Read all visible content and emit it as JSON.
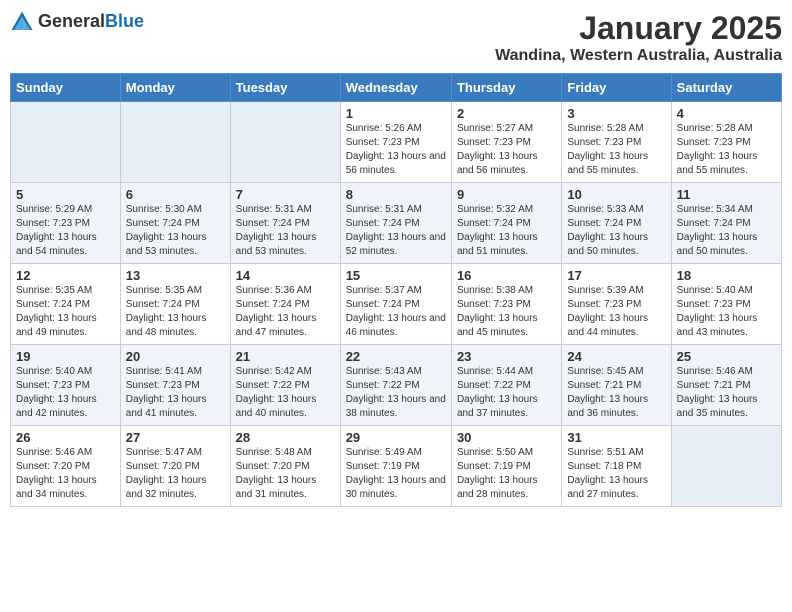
{
  "logo": {
    "general": "General",
    "blue": "Blue"
  },
  "header": {
    "month": "January 2025",
    "location": "Wandina, Western Australia, Australia"
  },
  "weekdays": [
    "Sunday",
    "Monday",
    "Tuesday",
    "Wednesday",
    "Thursday",
    "Friday",
    "Saturday"
  ],
  "weeks": [
    [
      {
        "day": "",
        "info": ""
      },
      {
        "day": "",
        "info": ""
      },
      {
        "day": "",
        "info": ""
      },
      {
        "day": "1",
        "info": "Sunrise: 5:26 AM\nSunset: 7:23 PM\nDaylight: 13 hours\nand 56 minutes."
      },
      {
        "day": "2",
        "info": "Sunrise: 5:27 AM\nSunset: 7:23 PM\nDaylight: 13 hours\nand 56 minutes."
      },
      {
        "day": "3",
        "info": "Sunrise: 5:28 AM\nSunset: 7:23 PM\nDaylight: 13 hours\nand 55 minutes."
      },
      {
        "day": "4",
        "info": "Sunrise: 5:28 AM\nSunset: 7:23 PM\nDaylight: 13 hours\nand 55 minutes."
      }
    ],
    [
      {
        "day": "5",
        "info": "Sunrise: 5:29 AM\nSunset: 7:23 PM\nDaylight: 13 hours\nand 54 minutes."
      },
      {
        "day": "6",
        "info": "Sunrise: 5:30 AM\nSunset: 7:24 PM\nDaylight: 13 hours\nand 53 minutes."
      },
      {
        "day": "7",
        "info": "Sunrise: 5:31 AM\nSunset: 7:24 PM\nDaylight: 13 hours\nand 53 minutes."
      },
      {
        "day": "8",
        "info": "Sunrise: 5:31 AM\nSunset: 7:24 PM\nDaylight: 13 hours\nand 52 minutes."
      },
      {
        "day": "9",
        "info": "Sunrise: 5:32 AM\nSunset: 7:24 PM\nDaylight: 13 hours\nand 51 minutes."
      },
      {
        "day": "10",
        "info": "Sunrise: 5:33 AM\nSunset: 7:24 PM\nDaylight: 13 hours\nand 50 minutes."
      },
      {
        "day": "11",
        "info": "Sunrise: 5:34 AM\nSunset: 7:24 PM\nDaylight: 13 hours\nand 50 minutes."
      }
    ],
    [
      {
        "day": "12",
        "info": "Sunrise: 5:35 AM\nSunset: 7:24 PM\nDaylight: 13 hours\nand 49 minutes."
      },
      {
        "day": "13",
        "info": "Sunrise: 5:35 AM\nSunset: 7:24 PM\nDaylight: 13 hours\nand 48 minutes."
      },
      {
        "day": "14",
        "info": "Sunrise: 5:36 AM\nSunset: 7:24 PM\nDaylight: 13 hours\nand 47 minutes."
      },
      {
        "day": "15",
        "info": "Sunrise: 5:37 AM\nSunset: 7:24 PM\nDaylight: 13 hours\nand 46 minutes."
      },
      {
        "day": "16",
        "info": "Sunrise: 5:38 AM\nSunset: 7:23 PM\nDaylight: 13 hours\nand 45 minutes."
      },
      {
        "day": "17",
        "info": "Sunrise: 5:39 AM\nSunset: 7:23 PM\nDaylight: 13 hours\nand 44 minutes."
      },
      {
        "day": "18",
        "info": "Sunrise: 5:40 AM\nSunset: 7:23 PM\nDaylight: 13 hours\nand 43 minutes."
      }
    ],
    [
      {
        "day": "19",
        "info": "Sunrise: 5:40 AM\nSunset: 7:23 PM\nDaylight: 13 hours\nand 42 minutes."
      },
      {
        "day": "20",
        "info": "Sunrise: 5:41 AM\nSunset: 7:23 PM\nDaylight: 13 hours\nand 41 minutes."
      },
      {
        "day": "21",
        "info": "Sunrise: 5:42 AM\nSunset: 7:22 PM\nDaylight: 13 hours\nand 40 minutes."
      },
      {
        "day": "22",
        "info": "Sunrise: 5:43 AM\nSunset: 7:22 PM\nDaylight: 13 hours\nand 38 minutes."
      },
      {
        "day": "23",
        "info": "Sunrise: 5:44 AM\nSunset: 7:22 PM\nDaylight: 13 hours\nand 37 minutes."
      },
      {
        "day": "24",
        "info": "Sunrise: 5:45 AM\nSunset: 7:21 PM\nDaylight: 13 hours\nand 36 minutes."
      },
      {
        "day": "25",
        "info": "Sunrise: 5:46 AM\nSunset: 7:21 PM\nDaylight: 13 hours\nand 35 minutes."
      }
    ],
    [
      {
        "day": "26",
        "info": "Sunrise: 5:46 AM\nSunset: 7:20 PM\nDaylight: 13 hours\nand 34 minutes."
      },
      {
        "day": "27",
        "info": "Sunrise: 5:47 AM\nSunset: 7:20 PM\nDaylight: 13 hours\nand 32 minutes."
      },
      {
        "day": "28",
        "info": "Sunrise: 5:48 AM\nSunset: 7:20 PM\nDaylight: 13 hours\nand 31 minutes."
      },
      {
        "day": "29",
        "info": "Sunrise: 5:49 AM\nSunset: 7:19 PM\nDaylight: 13 hours\nand 30 minutes."
      },
      {
        "day": "30",
        "info": "Sunrise: 5:50 AM\nSunset: 7:19 PM\nDaylight: 13 hours\nand 28 minutes."
      },
      {
        "day": "31",
        "info": "Sunrise: 5:51 AM\nSunset: 7:18 PM\nDaylight: 13 hours\nand 27 minutes."
      },
      {
        "day": "",
        "info": ""
      }
    ]
  ]
}
